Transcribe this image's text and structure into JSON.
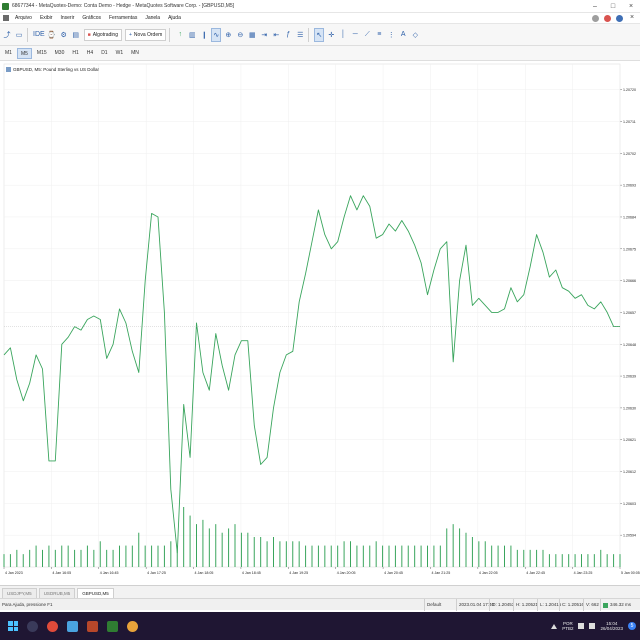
{
  "window": {
    "title": "68677344 - MetaQuotes-Demo: Conta Demo - Hedge - MetaQuotes Software Corp. - [GBPUSD,M5]"
  },
  "menu": {
    "items": [
      "Arquivo",
      "Exibir",
      "Inserir",
      "Gráficos",
      "Ferramentas",
      "Janela",
      "Ajuda"
    ]
  },
  "toolbar": {
    "algotrading_label": "Algotrading",
    "new_order_label": "Nova Ordem",
    "ide_label": "IDE"
  },
  "timeframes": [
    "M1",
    "M5",
    "M15",
    "M30",
    "H1",
    "H4",
    "D1",
    "W1",
    "MN"
  ],
  "active_timeframe": "M5",
  "chart": {
    "label": "GBPUSD, M5:  Pound Sterling vs US Dollar",
    "line_color": "#3aa55d",
    "volume_color": "#3aa55d",
    "grid_color": "#efefef"
  },
  "chart_data": {
    "type": "line",
    "title": "GBPUSD, M5:  Pound Sterling vs US Dollar",
    "ylim": [
      1.20585,
      1.20725
    ],
    "y_ticks": [
      "1.20720",
      "1.20711",
      "1.20702",
      "1.20693",
      "1.20684",
      "1.20675",
      "1.20666",
      "1.20657",
      "1.20648",
      "1.20639",
      "1.20630",
      "1.20621",
      "1.20612",
      "1.20603",
      "1.20594"
    ],
    "x_ticks": [
      "4 Jan 2023",
      "4 Jan 16:05",
      "4 Jan 16:45",
      "4 Jan 17:25",
      "4 Jan 18:05",
      "4 Jan 18:45",
      "4 Jan 19:25",
      "4 Jan 20:05",
      "4 Jan 20:45",
      "4 Jan 21:25",
      "4 Jan 22:05",
      "4 Jan 22:45",
      "4 Jan 23:25",
      "5 Jan 00:05"
    ],
    "price": [
      1.20645,
      1.20647,
      1.20638,
      1.20632,
      1.20637,
      1.20645,
      1.20641,
      1.20615,
      1.20615,
      1.20648,
      1.2065,
      1.20653,
      1.20652,
      1.20655,
      1.20656,
      1.20655,
      1.20644,
      1.20648,
      1.20658,
      1.20654,
      1.20646,
      1.2064,
      1.20666,
      1.20685,
      1.20684,
      1.20657,
      1.20607,
      1.20589,
      1.20631,
      1.20616,
      1.20654,
      1.2064,
      1.20635,
      1.20651,
      1.20642,
      1.20635,
      1.20645,
      1.20649,
      1.20649,
      1.20625,
      1.20614,
      1.20616,
      1.2063,
      1.2064,
      1.20645,
      1.20646,
      1.2066,
      1.20668,
      1.20677,
      1.20686,
      1.20679,
      1.20675,
      1.20677,
      1.20684,
      1.2069,
      1.20686,
      1.2069,
      1.20687,
      1.20678,
      1.20679,
      1.20682,
      1.2068,
      1.20683,
      1.2068,
      1.20676,
      1.20671,
      1.20662,
      1.20669,
      1.20675,
      1.20677,
      1.20643,
      1.20666,
      1.20676,
      1.20659,
      1.20661,
      1.20659,
      1.20657,
      1.20657,
      1.20658,
      1.20664,
      1.2066,
      1.20662,
      1.2067,
      1.20679,
      1.20674,
      1.20667,
      1.20669,
      1.20664,
      1.20663,
      1.20661,
      1.20662,
      1.20659,
      1.20658,
      1.2066,
      1.20657,
      1.20653,
      1.20653
    ]
  },
  "volume": {
    "values": [
      3,
      3,
      4,
      3,
      4,
      5,
      4,
      5,
      4,
      5,
      5,
      4,
      4,
      5,
      4,
      6,
      4,
      4,
      5,
      5,
      5,
      8,
      5,
      5,
      5,
      5,
      6,
      5,
      14,
      12,
      10,
      11,
      9,
      10,
      8,
      9,
      10,
      8,
      8,
      7,
      7,
      6,
      7,
      6,
      6,
      6,
      6,
      5,
      5,
      5,
      5,
      5,
      5,
      6,
      6,
      5,
      5,
      5,
      6,
      5,
      5,
      5,
      5,
      5,
      5,
      5,
      5,
      5,
      5,
      9,
      10,
      9,
      8,
      7,
      6,
      6,
      5,
      5,
      5,
      5,
      4,
      4,
      4,
      4,
      4,
      3,
      3,
      3,
      3,
      3,
      3,
      3,
      3,
      4,
      3,
      3,
      3
    ]
  },
  "tabs": [
    "USDJPY,M5",
    "USDRUB,M5",
    "GBPUSD,M5"
  ],
  "active_tab": "GBPUSD,M5",
  "status": {
    "help": "Para Ajuda, pressione F1",
    "profile": "Default",
    "datetime": "2023.01.04 17:40",
    "open": "O: 1.20453",
    "high": "H: 1.20521",
    "low": "L: 1.20415",
    "close": "C: 1.20516",
    "volume": "V: 662",
    "ping": "346.32 ms"
  },
  "taskbar": {
    "lang": "POR",
    "layout": "PTB2",
    "time": "15:04",
    "date": "26/04/2023",
    "notifications": "5"
  }
}
